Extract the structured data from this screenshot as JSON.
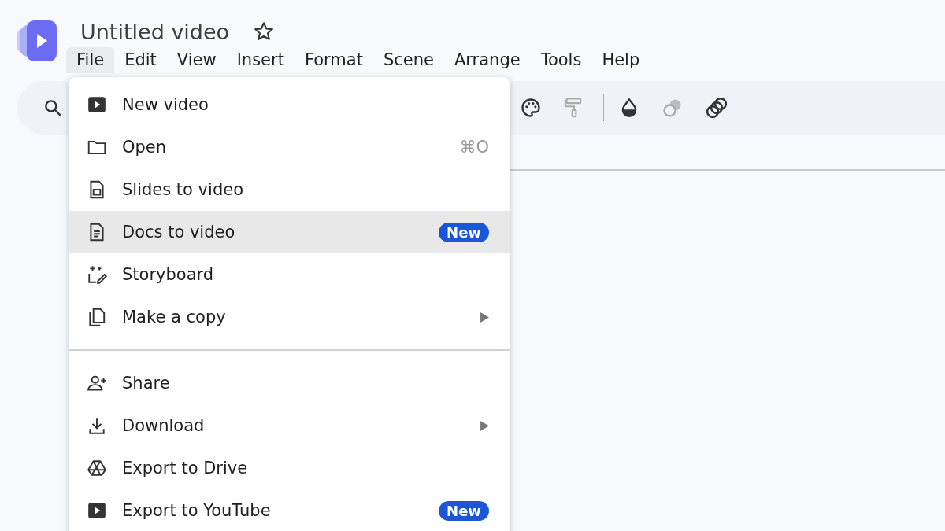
{
  "title": "Untitled video",
  "starred": false,
  "menubar": [
    {
      "label": "File",
      "selected": true
    },
    {
      "label": "Edit",
      "selected": false
    },
    {
      "label": "View",
      "selected": false
    },
    {
      "label": "Insert",
      "selected": false
    },
    {
      "label": "Format",
      "selected": false
    },
    {
      "label": "Scene",
      "selected": false
    },
    {
      "label": "Arrange",
      "selected": false
    },
    {
      "label": "Tools",
      "selected": false
    },
    {
      "label": "Help",
      "selected": false
    }
  ],
  "toolbar": [
    {
      "kind": "search",
      "disabled": false
    },
    {
      "kind": "palette",
      "disabled": false
    },
    {
      "kind": "roller",
      "disabled": true
    },
    {
      "kind": "divider"
    },
    {
      "kind": "drop",
      "disabled": false
    },
    {
      "kind": "circles",
      "disabled": true
    },
    {
      "kind": "rings",
      "disabled": false
    }
  ],
  "file_menu": [
    {
      "kind": "item",
      "label": "New video",
      "submenu": false,
      "selected": false
    },
    {
      "kind": "item",
      "label": "Open",
      "shortcut": "⌘O",
      "submenu": false,
      "selected": false
    },
    {
      "kind": "item",
      "label": "Slides to video",
      "submenu": false,
      "selected": false
    },
    {
      "kind": "item",
      "label": "Docs to video",
      "badge": "New",
      "submenu": false,
      "selected": true
    },
    {
      "kind": "item",
      "label": "Storyboard",
      "submenu": false,
      "selected": false
    },
    {
      "kind": "item",
      "label": "Make a copy",
      "submenu": true,
      "selected": false
    },
    {
      "kind": "separator"
    },
    {
      "kind": "item",
      "label": "Share",
      "submenu": false,
      "selected": false
    },
    {
      "kind": "item",
      "label": "Download",
      "submenu": true,
      "selected": false
    },
    {
      "kind": "item",
      "label": "Export to Drive",
      "submenu": false,
      "selected": false
    },
    {
      "kind": "item",
      "label": "Export to YouTube",
      "badge": "New",
      "submenu": false,
      "selected": false
    }
  ]
}
